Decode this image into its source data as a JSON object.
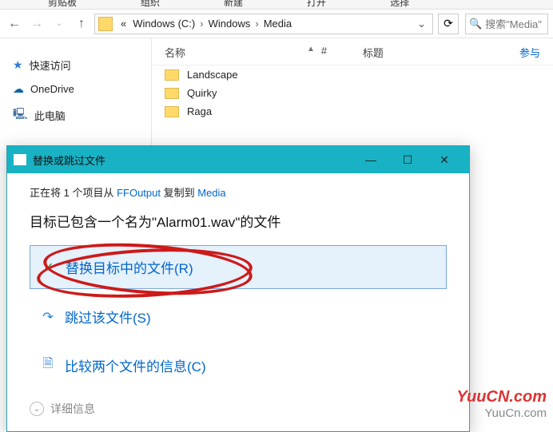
{
  "toolbar": {
    "items": [
      "剪贴板",
      "组织",
      "新建",
      "打开",
      "选择"
    ]
  },
  "nav": {
    "back": "←",
    "fwd": "→",
    "up": "↑"
  },
  "breadcrumb": {
    "prefix": "«",
    "parts": [
      "Windows (C:)",
      "Windows",
      "Media"
    ]
  },
  "refresh_icon": "⟳",
  "search": {
    "icon": "🔍",
    "placeholder": "搜索\"Media\""
  },
  "sidebar": {
    "items": [
      {
        "icon": "star",
        "label": "快速访问"
      },
      {
        "icon": "cloud",
        "label": "OneDrive"
      },
      {
        "icon": "pc",
        "label": "此电脑"
      }
    ]
  },
  "columns": {
    "name": "名称",
    "hash": "#",
    "title": "标题",
    "more": "参与"
  },
  "files": [
    "Landscape",
    "Quirky",
    "Raga"
  ],
  "dialog": {
    "title": "替换或跳过文件",
    "min": "—",
    "max": "☐",
    "close": "✕",
    "status_pre": "正在将 1 个项目从 ",
    "status_src": "FFOutput",
    "status_mid": " 复制到 ",
    "status_dst": "Media",
    "msg_pre": "目标已包含一个名为\"",
    "msg_file": "Alarm01.wav",
    "msg_post": "\"的文件",
    "opt_replace": "替换目标中的文件(R)",
    "opt_skip": "跳过该文件(S)",
    "opt_compare": "比较两个文件的信息(C)",
    "details_chev": "⌄",
    "details": "详细信息"
  },
  "watermark": {
    "a": "YuuCN.com",
    "b": "YuuCn.com"
  }
}
